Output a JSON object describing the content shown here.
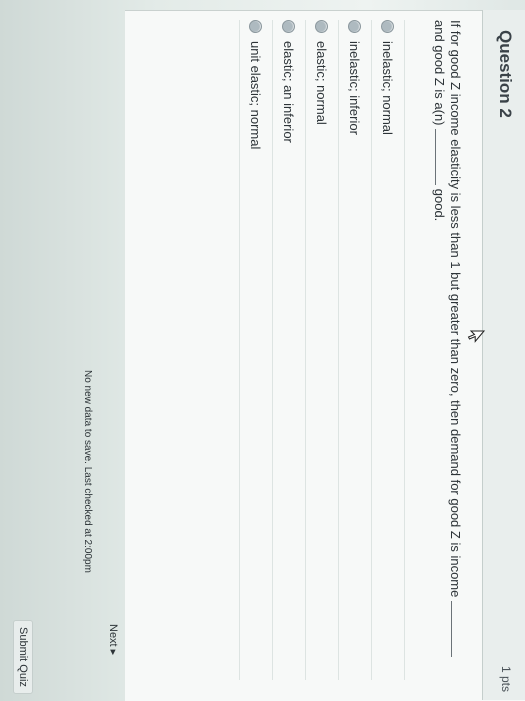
{
  "question": {
    "title": "Question 2",
    "points": "1 pts",
    "text_part1": "If for good Z income elasticity is less than 1 but greater than zero, then demand for good Z is income",
    "text_part2": "and good Z is a(n)",
    "text_part3": "good."
  },
  "choices": [
    {
      "label": "inelastic; normal"
    },
    {
      "label": "inelastic; inferior"
    },
    {
      "label": "elastic; normal"
    },
    {
      "label": "elastic; an inferior"
    },
    {
      "label": "unit elastic; normal"
    }
  ],
  "footer": {
    "next_label": "Next ▸",
    "status": "No new data to save. Last checked at 2:00pm",
    "submit_label": "Submit Quiz"
  },
  "colors": {
    "background": "#e3ebe8",
    "card": "#f7f9f8",
    "text": "#2d3438",
    "radio": "#aebac0"
  }
}
